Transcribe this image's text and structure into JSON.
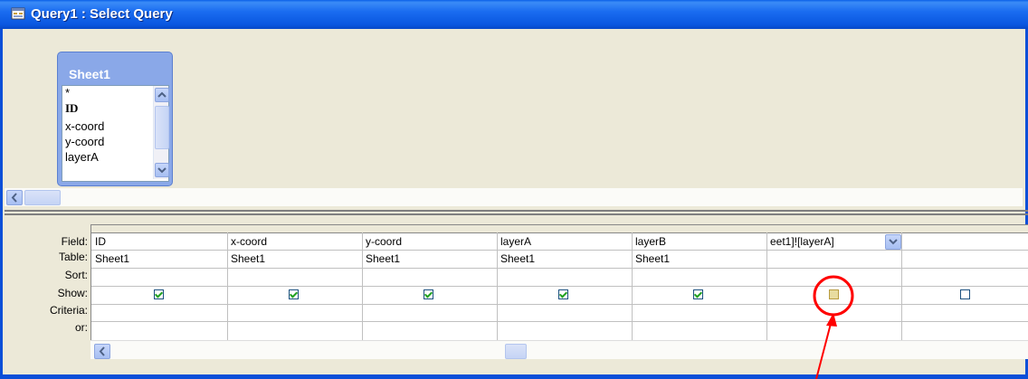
{
  "window": {
    "title": "Query1 : Select Query"
  },
  "table_box": {
    "title": "Sheet1",
    "fields": [
      "*",
      "ID",
      "x-coord",
      "y-coord",
      "layerA"
    ]
  },
  "qbe": {
    "row_labels": [
      "Field:",
      "Table:",
      "Sort:",
      "Show:",
      "Criteria:",
      "or:"
    ],
    "columns": [
      {
        "field": "ID",
        "table": "Sheet1",
        "show": true
      },
      {
        "field": "x-coord",
        "table": "Sheet1",
        "show": true
      },
      {
        "field": "y-coord",
        "table": "Sheet1",
        "show": true
      },
      {
        "field": "layerA",
        "table": "Sheet1",
        "show": true
      },
      {
        "field": "layerB",
        "table": "Sheet1",
        "show": true
      },
      {
        "field": "eet1]![layerA]",
        "table": "",
        "show": false
      },
      {
        "field": "",
        "table": "",
        "show": false
      }
    ]
  },
  "annotation": {
    "color": "#ff0000"
  },
  "icons": {
    "window": "query-window-icon",
    "combo": "chevron-down-icon",
    "scroll_up": "arrow-up-icon",
    "scroll_down": "arrow-down-icon",
    "scroll_left": "arrow-left-icon"
  }
}
